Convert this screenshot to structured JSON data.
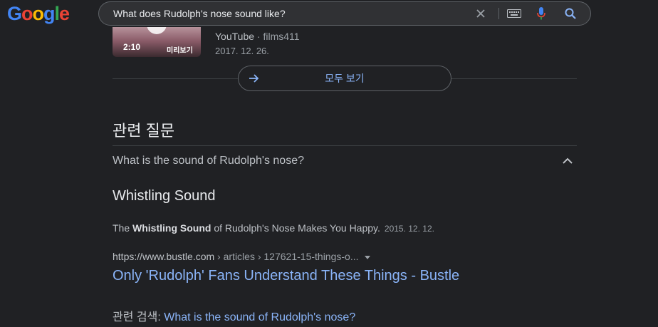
{
  "header": {
    "logo": {
      "letters": [
        "G",
        "o",
        "o",
        "g",
        "l",
        "e"
      ],
      "colors": [
        "#4285f4",
        "#ea4335",
        "#fbbc05",
        "#4285f4",
        "#34a853",
        "#ea4335"
      ]
    },
    "search": {
      "query": "What does Rudolph's nose sound like?"
    },
    "icons": [
      "clear-icon",
      "keyboard-icon",
      "mic-icon",
      "search-icon"
    ]
  },
  "video": {
    "duration": "2:10",
    "preview_label": "미리보기",
    "source": "YouTube",
    "separator": "·",
    "channel": "films411",
    "date": "2017. 12. 26."
  },
  "see_all": {
    "label": "모두 보기"
  },
  "related_questions": {
    "title": "관련 질문",
    "question": "What is the sound of Rudolph's nose?",
    "answer": "Whistling Sound",
    "snippet": {
      "pre": "The ",
      "bold": "Whistling Sound",
      "post": " of Rudolph's Nose Makes You Happy.",
      "date": "2015. 12. 12."
    },
    "cite": {
      "domain": "https://www.bustle.com",
      "path": " › articles › 127621-15-things-o..."
    },
    "result_title": "Only 'Rudolph' Fans Understand These Things - Bustle",
    "related_search_label": "관련 검색: ",
    "related_search_link": "What is the sound of Rudolph's nose?"
  },
  "colors": {
    "background": "#202124",
    "link": "#8ab4f8",
    "text": "#bdc1c6"
  }
}
